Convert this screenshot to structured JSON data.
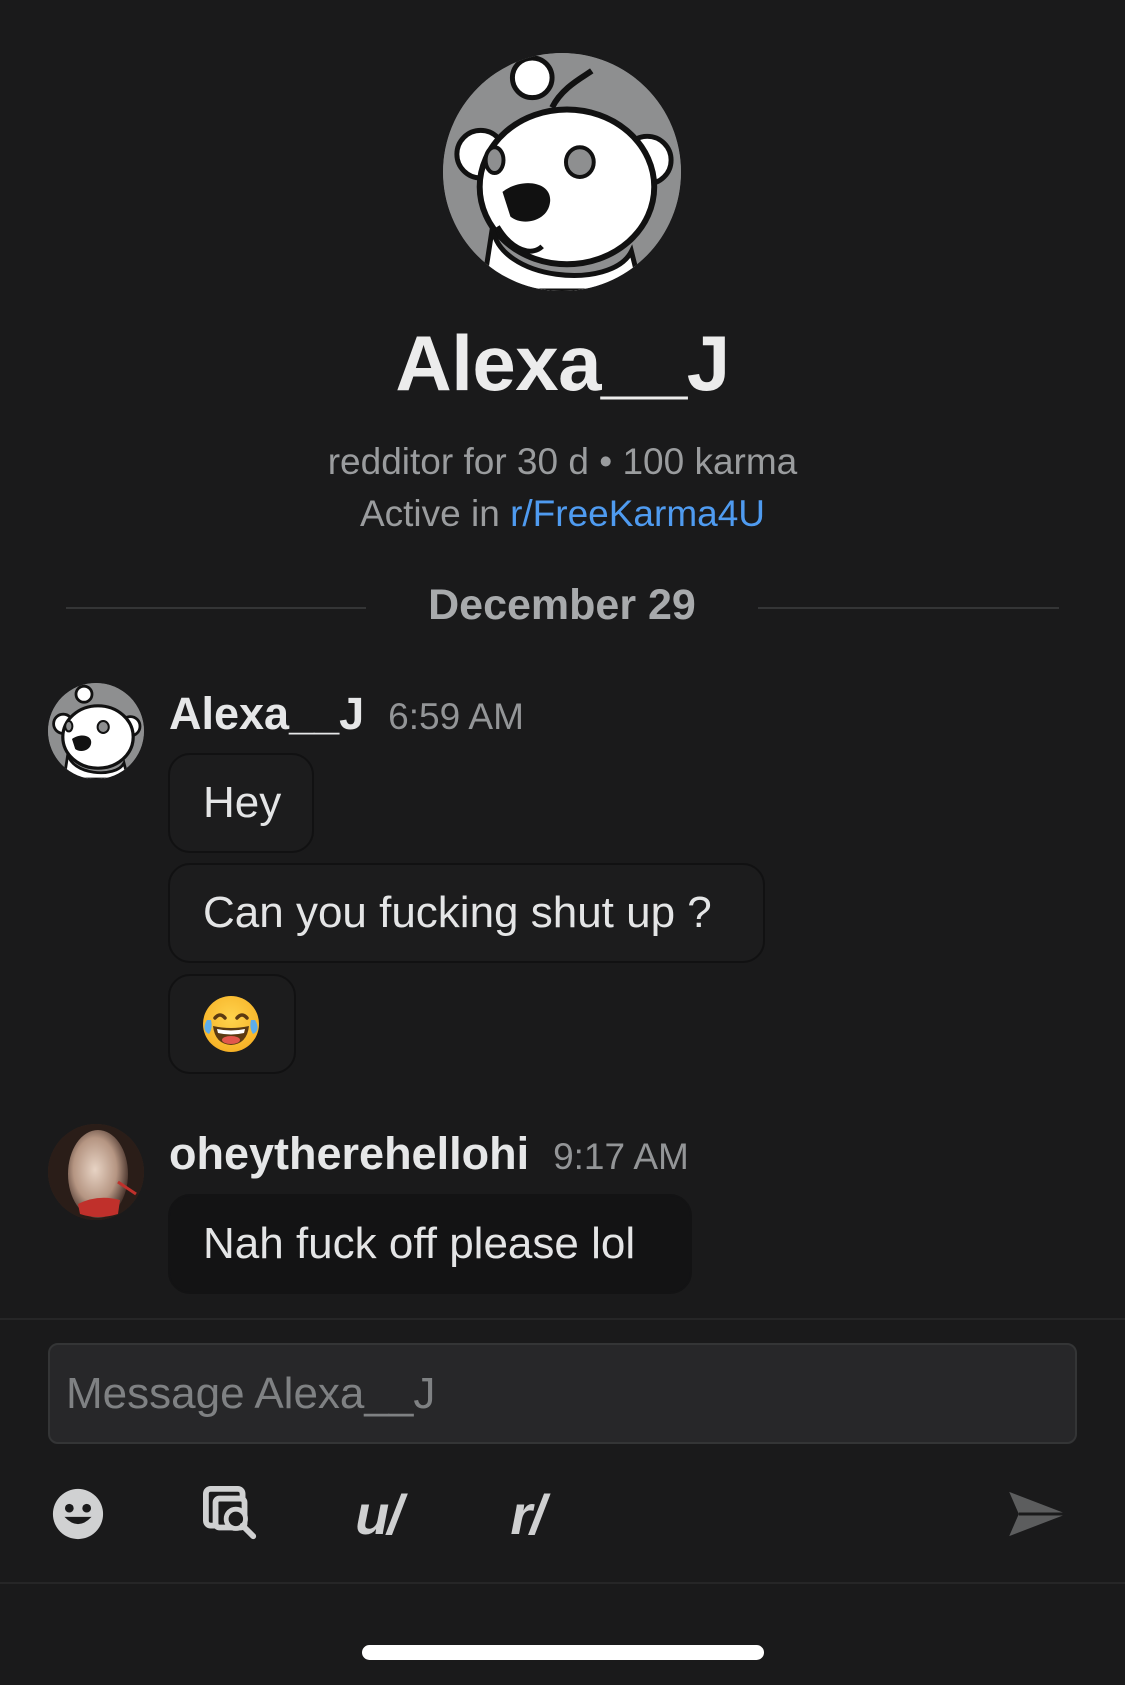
{
  "profile": {
    "name": "Alexa__J",
    "meta_line1": "redditor for 30 d • 100 karma",
    "active_prefix": "Active in ",
    "active_link": "r/FreeKarma4U"
  },
  "divider": {
    "date": "December 29"
  },
  "messages": [
    {
      "author": "Alexa__J",
      "time": "6:59 AM",
      "bubbles": [
        "Hey",
        "Can you fucking shut up ?"
      ],
      "emoji": "face-with-tears-of-joy"
    },
    {
      "author": "oheytherehellohi",
      "time": "9:17 AM",
      "bubbles": [
        "Nah fuck off please lol"
      ]
    }
  ],
  "composer": {
    "placeholder": "Message Alexa__J",
    "tools": {
      "emoji": "smiley-icon",
      "media": "image-search-icon",
      "user_label": "u/",
      "subreddit_label": "r/",
      "send": "send-icon"
    }
  },
  "colors": {
    "background": "#1a1a1b",
    "link": "#4f9bf0",
    "avatar_grey": "#8e8f90"
  }
}
